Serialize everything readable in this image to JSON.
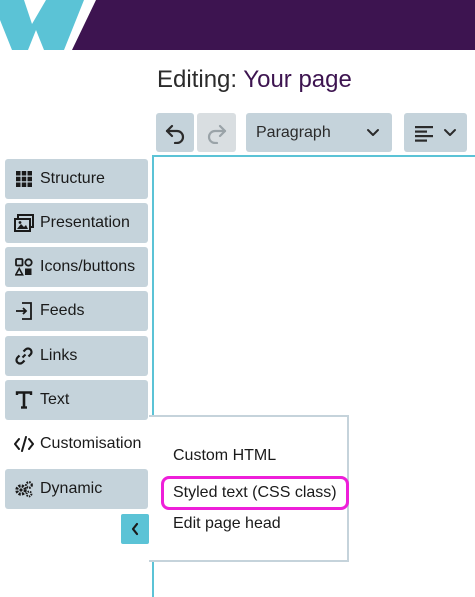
{
  "header": {
    "brand_dark": "#3d1450",
    "brand_light": "#5bc3d6"
  },
  "page_title": {
    "prefix": "Editing:",
    "name": "Your page"
  },
  "toolbar": {
    "undo_icon": "undo-icon",
    "redo_icon": "redo-icon",
    "format_value": "Paragraph",
    "align_icon": "align-left-icon"
  },
  "sidebar": {
    "items": [
      {
        "label": "Structure",
        "icon": "grid-icon"
      },
      {
        "label": "Presentation",
        "icon": "images-icon"
      },
      {
        "label": "Icons/buttons",
        "icon": "shapes-icon"
      },
      {
        "label": "Feeds",
        "icon": "import-icon"
      },
      {
        "label": "Links",
        "icon": "link-icon"
      },
      {
        "label": "Text",
        "icon": "text-icon"
      },
      {
        "label": "Customisation",
        "icon": "code-icon"
      },
      {
        "label": "Dynamic",
        "icon": "gears-icon"
      }
    ],
    "active_index": 6
  },
  "popup": {
    "items": [
      {
        "label": "Custom HTML"
      },
      {
        "label": "Styled text (CSS class)"
      },
      {
        "label": "Edit page head"
      }
    ],
    "highlight_color": "#ee1fd9"
  }
}
